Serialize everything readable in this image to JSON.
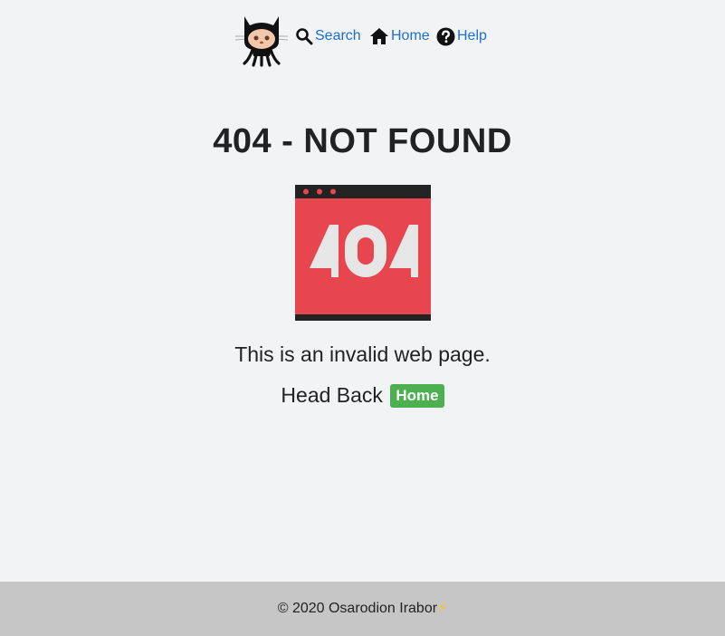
{
  "nav": {
    "logo_icon": "octocat-logo-icon",
    "search_label": "Search",
    "search_icon": "search-icon",
    "home_label": "Home",
    "home_icon": "home-icon",
    "help_label": "Help",
    "help_icon": "help-circle-icon",
    "link_color": "#1a6fd6"
  },
  "main": {
    "title": "404 - NOT FOUND",
    "illustration": {
      "icon": "404-browser-window-icon",
      "text": "404",
      "bg_color": "#e8464f",
      "bar_color": "#232323"
    },
    "message": "This is an invalid web page.",
    "head_back_text": "Head Back",
    "home_button_label": "Home",
    "home_button_color": "#4caf50"
  },
  "footer": {
    "copyright": "© 2020 Osarodion Irabor",
    "bolt": "⚡",
    "bg_color": "#c6c6c6"
  }
}
